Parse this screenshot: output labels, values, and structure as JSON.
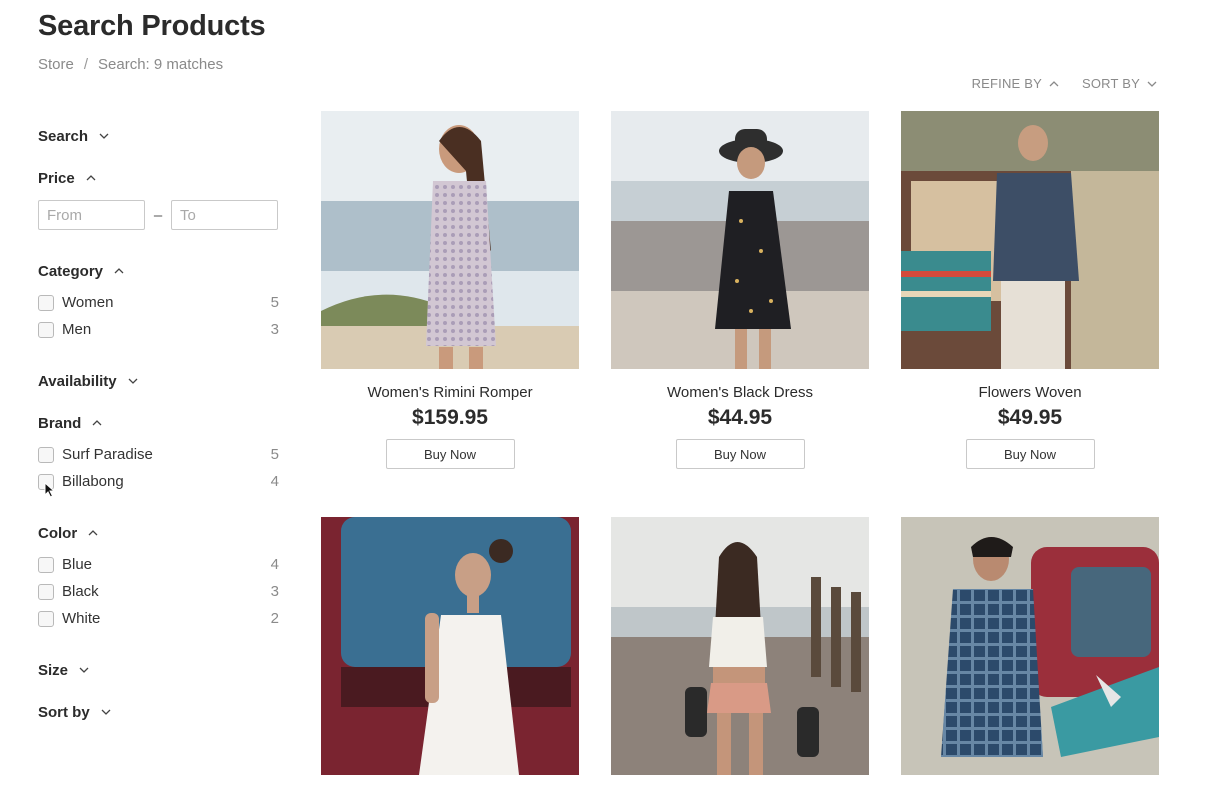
{
  "page": {
    "title": "Search Products",
    "breadcrumb": {
      "root": "Store",
      "separator": "/",
      "current": "Search: 9 matches"
    }
  },
  "top_controls": {
    "refine_label": "REFINE BY",
    "sort_label": "SORT BY"
  },
  "sidebar": {
    "search": {
      "label": "Search"
    },
    "price": {
      "label": "Price",
      "from_placeholder": "From",
      "to_placeholder": "To",
      "dash": "–"
    },
    "category": {
      "label": "Category",
      "options": [
        {
          "label": "Women",
          "count": "5"
        },
        {
          "label": "Men",
          "count": "3"
        }
      ]
    },
    "availability": {
      "label": "Availability"
    },
    "brand": {
      "label": "Brand",
      "options": [
        {
          "label": "Surf Paradise",
          "count": "5"
        },
        {
          "label": "Billabong",
          "count": "4"
        }
      ]
    },
    "color": {
      "label": "Color",
      "options": [
        {
          "label": "Blue",
          "count": "4"
        },
        {
          "label": "Black",
          "count": "3"
        },
        {
          "label": "White",
          "count": "2"
        }
      ]
    },
    "size": {
      "label": "Size"
    },
    "sort_by": {
      "label": "Sort by"
    }
  },
  "products": [
    {
      "name": "Women's Rimini Romper",
      "price": "$159.95",
      "button": "Buy Now"
    },
    {
      "name": "Women's Black Dress",
      "price": "$44.95",
      "button": "Buy Now"
    },
    {
      "name": "Flowers Woven",
      "price": "$49.95",
      "button": "Buy Now"
    },
    {
      "name": "",
      "price": "",
      "button": ""
    },
    {
      "name": "",
      "price": "",
      "button": ""
    },
    {
      "name": "",
      "price": "",
      "button": ""
    }
  ],
  "icons": {
    "chevron_down": "chevron-down-icon",
    "chevron_up": "chevron-up-icon",
    "cursor": "mouse-pointer-icon"
  },
  "colors": {
    "text": "#2b2b2b",
    "muted": "#8a8a8a",
    "border": "#c9c9c9"
  }
}
